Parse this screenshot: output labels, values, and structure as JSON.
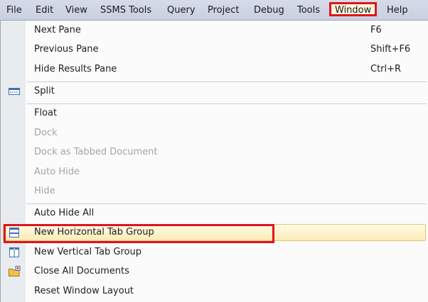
{
  "menubar": {
    "items": [
      "File",
      "Edit",
      "View",
      "SSMS Tools",
      "Query",
      "Project",
      "Debug",
      "Tools",
      "Window",
      "Help"
    ]
  },
  "window_menu": {
    "items": [
      {
        "label": "Next Pane",
        "shortcut": "F6",
        "enabled": true
      },
      {
        "label": "Previous Pane",
        "shortcut": "Shift+F6",
        "enabled": true
      },
      {
        "label": "Hide Results Pane",
        "shortcut": "Ctrl+R",
        "enabled": true
      },
      {
        "label": "Split",
        "shortcut": "",
        "enabled": true,
        "icon": "split-window-icon"
      },
      {
        "label": "Float",
        "shortcut": "",
        "enabled": true
      },
      {
        "label": "Dock",
        "shortcut": "",
        "enabled": false
      },
      {
        "label": "Dock as Tabbed Document",
        "shortcut": "",
        "enabled": false
      },
      {
        "label": "Auto Hide",
        "shortcut": "",
        "enabled": false
      },
      {
        "label": "Hide",
        "shortcut": "",
        "enabled": false
      },
      {
        "label": "Auto Hide All",
        "shortcut": "",
        "enabled": true
      },
      {
        "label": "New Horizontal Tab Group",
        "shortcut": "",
        "enabled": true,
        "icon": "horizontal-tab-group-icon",
        "highlighted": true
      },
      {
        "label": "New Vertical Tab Group",
        "shortcut": "",
        "enabled": true,
        "icon": "vertical-tab-group-icon"
      },
      {
        "label": "Close All Documents",
        "shortcut": "",
        "enabled": true,
        "icon": "folder-close-icon"
      },
      {
        "label": "Reset Window Layout",
        "shortcut": "",
        "enabled": true
      }
    ]
  },
  "colors": {
    "menubar_bg": "#ccd5e8",
    "highlight_fill": "#fdebb4",
    "annotation_red": "#e0141e",
    "disabled_text": "#a4a4a4"
  }
}
